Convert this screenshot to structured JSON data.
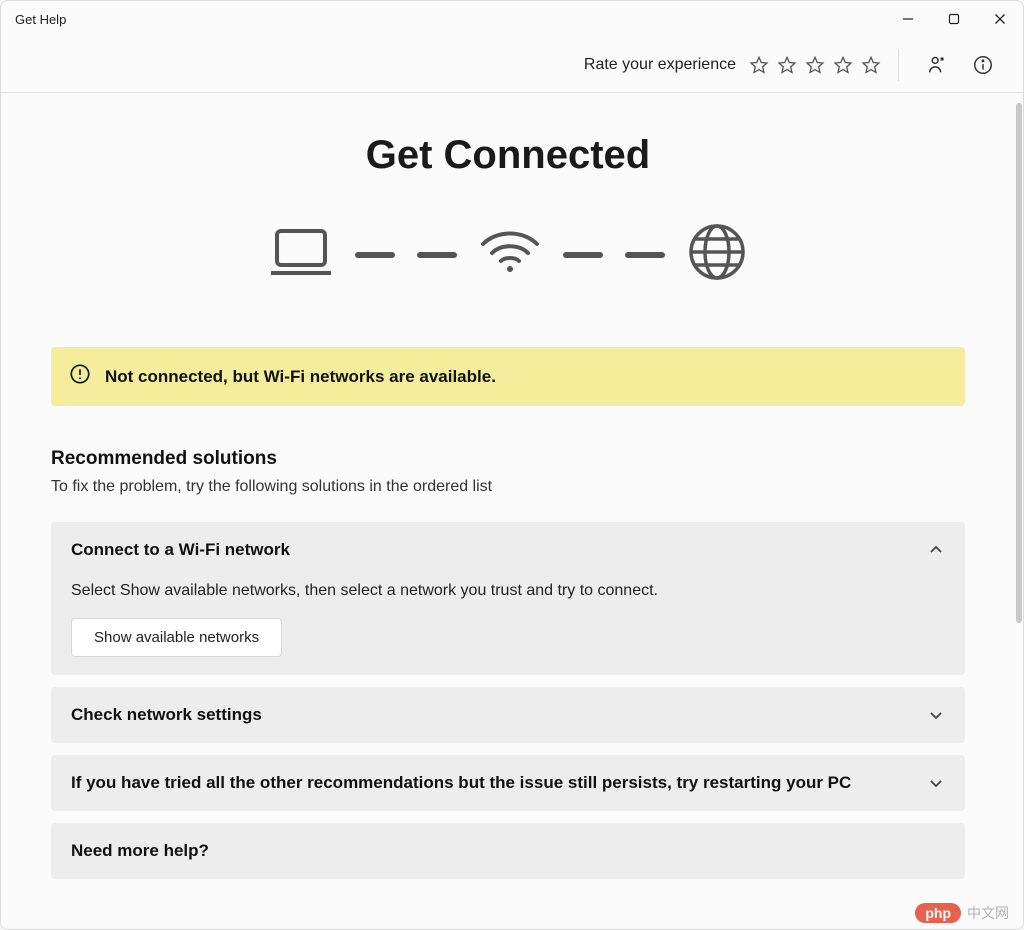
{
  "window": {
    "title": "Get Help"
  },
  "rating": {
    "label": "Rate your experience"
  },
  "page": {
    "title": "Get Connected"
  },
  "banner": {
    "text": "Not connected, but Wi-Fi networks are available."
  },
  "sections": {
    "recommended": {
      "heading": "Recommended solutions",
      "subheading": "To fix the problem, try the following solutions in the ordered list"
    }
  },
  "cards": [
    {
      "title": "Connect to a Wi-Fi network",
      "desc": "Select Show available networks, then select a network you trust and try to connect.",
      "button": "Show available networks"
    },
    {
      "title": "Check network settings"
    },
    {
      "title": "If you have tried all the other recommendations but the issue still persists, try restarting your PC"
    },
    {
      "title": "Need more help?"
    }
  ],
  "watermark": {
    "pill": "php",
    "text": "中文网"
  }
}
